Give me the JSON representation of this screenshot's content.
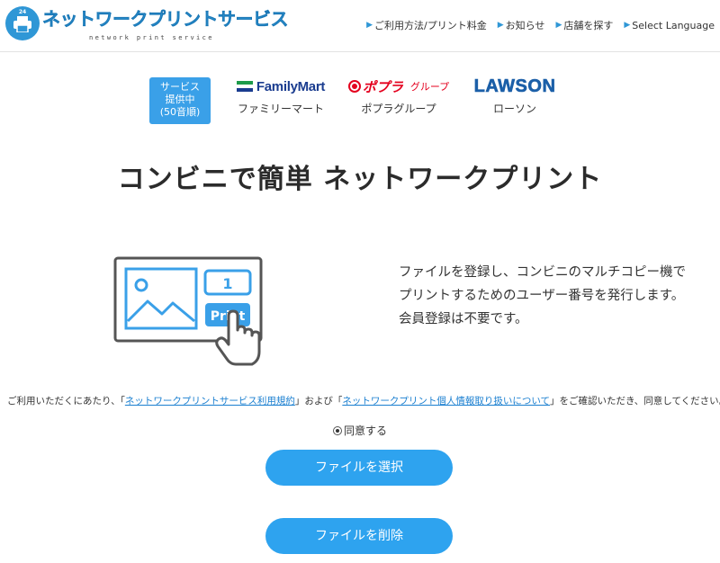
{
  "header": {
    "logo_number": "24",
    "logo_title": "ネットワークプリントサービス",
    "logo_subtitle": "network print service",
    "nav": [
      {
        "label": "ご利用方法/プリント料金"
      },
      {
        "label": "お知らせ"
      },
      {
        "label": "店舗を探す"
      },
      {
        "label": "Select Language"
      }
    ]
  },
  "partners": {
    "badge_lines": [
      "サービス",
      "提供中",
      "(50音順)"
    ],
    "familymart": {
      "logo": "FamilyMart",
      "name": "ファミリーマート"
    },
    "poplar": {
      "logo": "ポプラ",
      "logo_group": "グループ",
      "name": "ポプラグループ"
    },
    "lawson": {
      "logo": "LAWSON",
      "name": "ローソン"
    }
  },
  "headline": "コンビニで簡単 ネットワークプリント",
  "illustration": {
    "number": "1",
    "print_label": "Print"
  },
  "description": [
    "ファイルを登録し、コンビニのマルチコピー機で",
    "プリントするためのユーザー番号を発行します。",
    "会員登録は不要です。"
  ],
  "terms": {
    "prefix": "ご利用いただくにあたり、「",
    "link1": "ネットワークプリントサービス利用規約",
    "middle": "」および「",
    "link2": "ネットワークプリント個人情報取り扱いについて",
    "suffix": "」をご確認いただき、同意してください。"
  },
  "agree_label": "同意する",
  "buttons": {
    "select": "ファイルを選択",
    "delete": "ファイルを削除"
  },
  "colors": {
    "accent": "#2ea3ef",
    "brand": "#2f97d6",
    "familymart_blue": "#1a3c8f",
    "poplar_red": "#e4001e",
    "lawson_blue": "#1b5fa8"
  }
}
